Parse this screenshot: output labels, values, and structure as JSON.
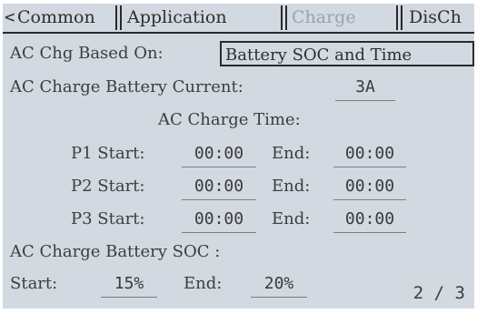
{
  "tabs": {
    "left_arrow": "<",
    "items": [
      {
        "label": "Common"
      },
      {
        "label": "Application"
      },
      {
        "label": "Charge"
      },
      {
        "label": "DisCh"
      }
    ],
    "active_index": 2
  },
  "ac_chg_based_on": {
    "label": "AC Chg Based On:",
    "value": "Battery SOC  and Time"
  },
  "ac_charge_battery_current": {
    "label": "AC Charge Battery Current:",
    "value": "3A"
  },
  "ac_charge_time": {
    "title": "AC Charge Time:",
    "periods": [
      {
        "start_label": "P1 Start:",
        "start": "00:00",
        "end_label": "End:",
        "end": "00:00"
      },
      {
        "start_label": "P2 Start:",
        "start": "00:00",
        "end_label": "End:",
        "end": "00:00"
      },
      {
        "start_label": "P3 Start:",
        "start": "00:00",
        "end_label": "End:",
        "end": "00:00"
      }
    ]
  },
  "ac_charge_battery_soc": {
    "label": "AC Charge Battery SOC :",
    "start_label": "Start:",
    "start": "15%",
    "end_label": "End:",
    "end": "20%"
  },
  "page": "2 / 3",
  "colors": {
    "background": "#d2d9e1",
    "active_tab_text": "#9aa3ad",
    "text": "#3d3d3d"
  }
}
